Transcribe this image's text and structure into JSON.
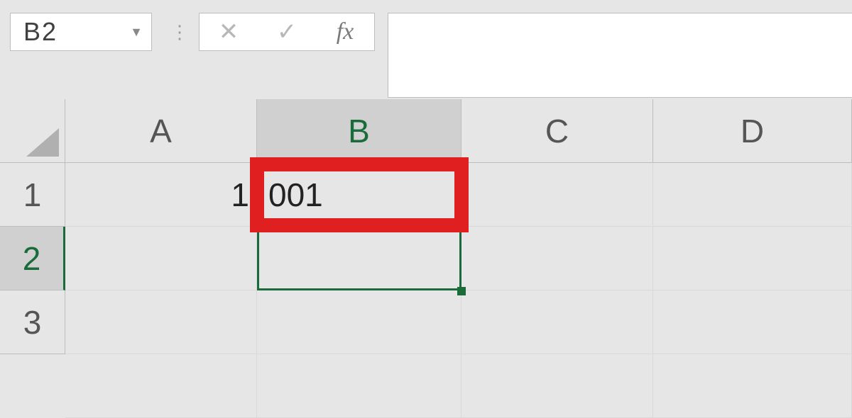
{
  "nameBox": {
    "value": "B2"
  },
  "formulaBar": {
    "cancelIcon": "✕",
    "enterIcon": "✓",
    "fxLabel": "fx",
    "value": ""
  },
  "columns": {
    "a": "A",
    "b": "B",
    "c": "C",
    "d": "D"
  },
  "rows": {
    "r1": "1",
    "r2": "2",
    "r3": "3"
  },
  "cells": {
    "A1": "1",
    "B1": "001"
  },
  "selection": {
    "activeCell": "B2",
    "highlightedCell": "B1"
  }
}
